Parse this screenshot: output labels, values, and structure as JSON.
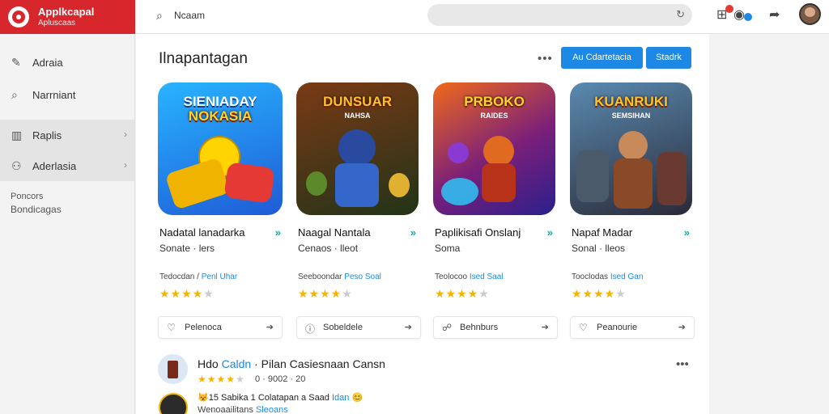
{
  "brand": {
    "name": "Applkcapal",
    "sub": "Apluscaas"
  },
  "topbar": {
    "search_icon": "search-icon",
    "search_text": "Ncaam",
    "searchbox_icon": "refresh-icon",
    "icons": [
      "grid-icon",
      "notification-icon",
      "share-icon"
    ]
  },
  "sidebar": {
    "items": [
      {
        "label": "Adraia",
        "icon": "pen-icon",
        "chevron": false
      },
      {
        "label": "Narrniant",
        "icon": "search-icon",
        "chevron": false
      },
      {
        "label": "Raplis",
        "icon": "book-icon",
        "chevron": true
      },
      {
        "label": "Aderlasia",
        "icon": "group-icon",
        "chevron": true
      }
    ],
    "captions": [
      "Poncors",
      "Bondicagas"
    ]
  },
  "main": {
    "section_title": "Ilnapantagan",
    "more_label": "•••",
    "buttons": [
      "Au Cdartetacia",
      "Stadrk"
    ],
    "cards": [
      {
        "art_title": "SIENIADAY",
        "art_title2": "NOKASIA",
        "art_sub": "",
        "name": "Nadatal lanadarka",
        "category": "Sonate · lers",
        "release_prefix": "Tedocdan / ",
        "release_link": "Penl Uhar",
        "rating": 4,
        "action": "Pelenoca",
        "action_icon": "heart-icon",
        "colors": [
          "#1aa3ff",
          "#1f5bd6"
        ]
      },
      {
        "art_title": "DUNSUAR",
        "art_title2": "",
        "art_sub": "NAHSA",
        "name": "Naagal Nantala",
        "category": "Cenaos · lleot",
        "release_prefix": "Seeboondar ",
        "release_link": "Peso Soal",
        "rating": 4,
        "action": "Sobeldele",
        "action_icon": "info-icon",
        "colors": [
          "#6b2f12",
          "#2a3d1c"
        ]
      },
      {
        "art_title": "PRBOKO",
        "art_title2": "",
        "art_sub": "RAIDES",
        "name": "Paplikisafi Onslanj",
        "category": "Soma",
        "release_prefix": "Teolocoo ",
        "release_link": "Ised Saal",
        "rating": 4,
        "action": "Behnburs",
        "action_icon": "link-icon",
        "colors": [
          "#d94a1a",
          "#4a1c8c"
        ]
      },
      {
        "art_title": "KUANRUKI",
        "art_title2": "",
        "art_sub": "SEMSIHAN",
        "name": "Napaf Madar",
        "category": "Sonal · lleos",
        "release_prefix": "Tooclodas ",
        "release_link": "Ised Gan",
        "rating": 4,
        "action": "Peanourie",
        "action_icon": "heart-icon",
        "colors": [
          "#3a5a78",
          "#2a2430"
        ]
      }
    ]
  },
  "feed": {
    "title_a": "Hdo ",
    "title_hl": "Caldn",
    "title_b": " · Pilan Casiesnaan Cansn",
    "rating": 4,
    "meta": "0 · 9002 · 20",
    "line1_a": "😾15 Sabika 1 Colatapan a Saad ",
    "line1_hl": "Idan",
    "line1_b": " 😊",
    "line2_a": "Wenoaailitans ",
    "line2_hl": "Sleoans"
  },
  "colors": {
    "brand": "#d7262c",
    "accent": "#1e88e5",
    "star": "#f4b400"
  }
}
